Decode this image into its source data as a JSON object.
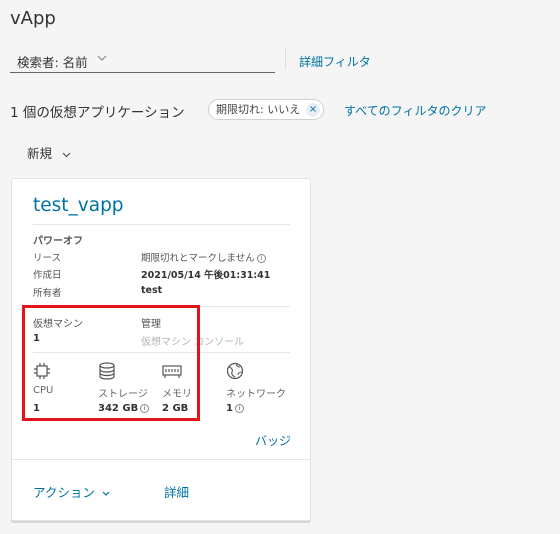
{
  "page": {
    "title": "vApp"
  },
  "search": {
    "label": "検索者: 名前",
    "advanced_filter": "詳細フィルタ"
  },
  "results": {
    "count_text": "1 個の仮想アプリケーション",
    "filter_chip": {
      "label": "期限切れ: いいえ",
      "close": "×"
    },
    "clear_filters": "すべてのフィルタのクリア"
  },
  "toolbar": {
    "new_label": "新規"
  },
  "card": {
    "title": "test_vapp",
    "status": "パワーオフ",
    "properties": [
      {
        "label": "リース",
        "value": "期限切れとマークしません"
      },
      {
        "label": "作成日",
        "value": "2021/05/14 午後01:31:41"
      },
      {
        "label": "所有者",
        "value": "test"
      }
    ],
    "vms": {
      "label": "仮想マシン",
      "count": "1"
    },
    "management": {
      "label": "管理",
      "console_link": "仮想マシン コンソール"
    },
    "resources": [
      {
        "icon": "cpu-icon",
        "label": "CPU",
        "value": "1"
      },
      {
        "icon": "storage-icon",
        "label": "ストレージ",
        "value": "342 GB"
      },
      {
        "icon": "memory-icon",
        "label": "メモリ",
        "value": "2 GB"
      },
      {
        "icon": "network-icon",
        "label": "ネットワーク",
        "value": "1"
      }
    ],
    "badge_link": "バッジ",
    "actions_link": "アクション",
    "details_link": "詳細"
  },
  "colors": {
    "link": "#0072a3",
    "highlight": "#e3141c",
    "background": "#f5f5f5"
  }
}
